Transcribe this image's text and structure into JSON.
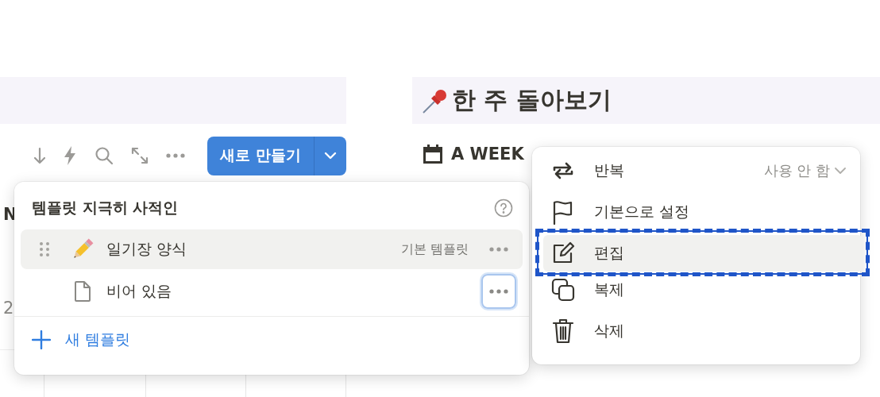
{
  "page_title": {
    "text": "한 주 돌아보기"
  },
  "toolbar": {
    "new_button": "새로 만들기"
  },
  "view_tab": {
    "label": "A WEEK"
  },
  "table_fragments": [
    "N",
    "2"
  ],
  "template_popup": {
    "title": "템플릿 지극히 사적인",
    "add_label": "새 템플릿",
    "templates": [
      {
        "kind": "pencil",
        "name": "일기장 양식",
        "badge": "기본 템플릿",
        "selected": true,
        "menu_focused": false
      },
      {
        "kind": "page",
        "name": "비어 있음",
        "selected": false,
        "menu_focused": true
      }
    ]
  },
  "context_menu": {
    "items": [
      {
        "kind": "repeat",
        "label": "반복",
        "value": "사용 안 함",
        "selected": false
      },
      {
        "kind": "flag",
        "label": "기본으로 설정",
        "selected": false
      },
      {
        "kind": "edit",
        "label": "편집",
        "selected": true
      },
      {
        "kind": "duplicate",
        "label": "복제",
        "selected": false
      },
      {
        "kind": "trash",
        "label": "삭제",
        "selected": false
      }
    ]
  }
}
